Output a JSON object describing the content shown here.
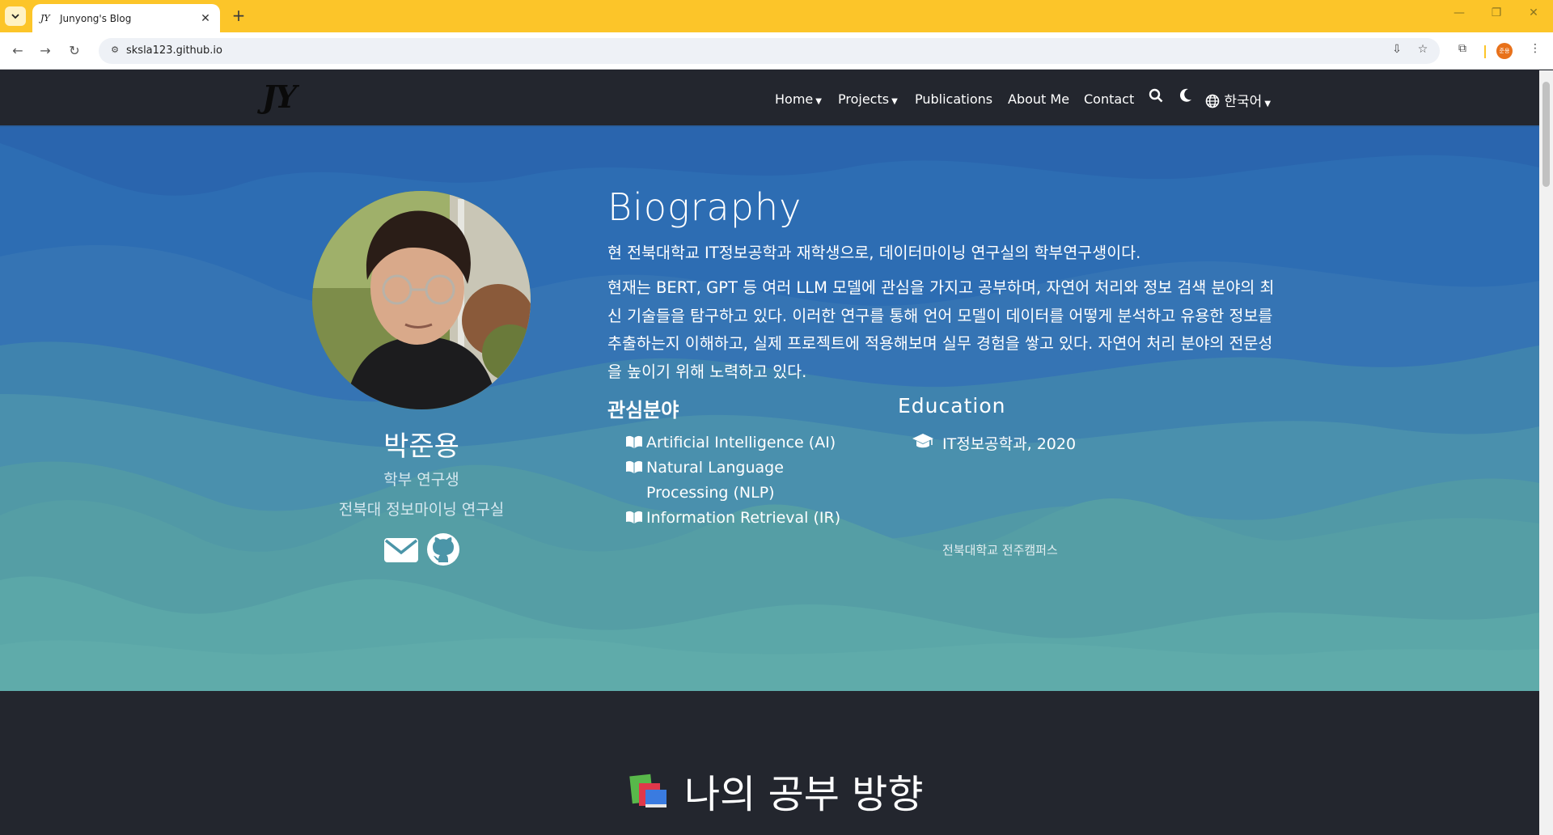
{
  "browser": {
    "tab_title": "Junyong's Blog",
    "tab_favicon_text": "JY",
    "url": "sksla123.github.io",
    "profile_initials": "준용"
  },
  "site": {
    "logo": "JY",
    "nav": {
      "home": "Home",
      "projects": "Projects",
      "publications": "Publications",
      "about": "About Me",
      "contact": "Contact",
      "language": "한국어"
    }
  },
  "profile": {
    "name": "박준용",
    "role": "학부 연구생",
    "lab": "전북대 정보마이닝 연구실"
  },
  "biography": {
    "heading": "Biography",
    "intro": "현 전북대학교 IT정보공학과 재학생으로, 데이터마이닝 연구실의 학부연구생이다.",
    "paragraph": "현재는 BERT, GPT 등 여러 LLM 모델에 관심을 가지고 공부하며, 자연어 처리와 정보 검색 분야의 최신 기술들을 탐구하고 있다. 이러한 연구를 통해 언어 모델이 데이터를 어떻게 분석하고 유용한 정보를 추출하는지 이해하고, 실제 프로젝트에 적용해보며 실무 경험을 쌓고 있다. 자연어 처리 분야의 전문성을 높이기 위해 노력하고 있다."
  },
  "interests": {
    "heading": "관심분야",
    "items": [
      "Artificial Intelligence (AI)",
      "Natural Language Processing (NLP)",
      "Information Retrieval (IR)"
    ]
  },
  "education": {
    "heading": "Education",
    "degree": "IT정보공학과, 2020",
    "school": "전북대학교 전주캠퍼스"
  },
  "study": {
    "heading": "나의 공부 방향"
  },
  "colors": {
    "chrome_accent": "#fcc529",
    "nav_bg": "#23262e",
    "hero_blue": "#2a68b0",
    "hero_teal": "#5aa9a6"
  }
}
